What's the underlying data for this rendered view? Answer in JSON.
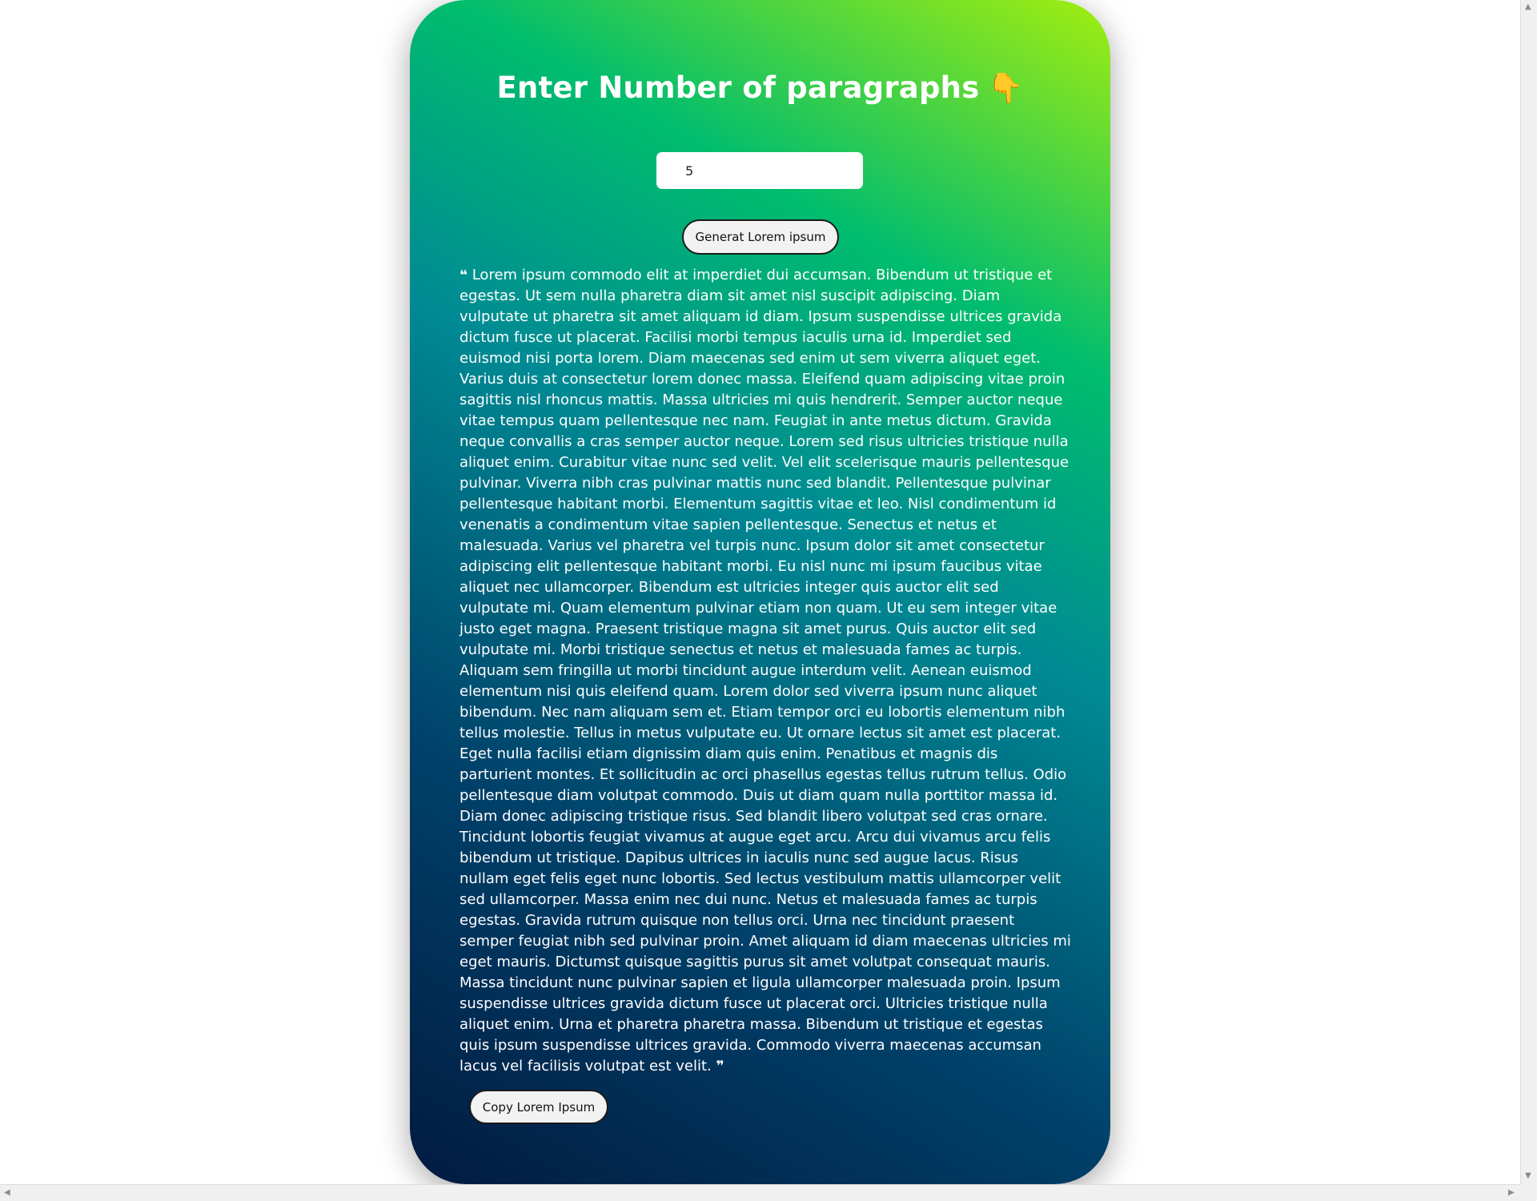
{
  "header": {
    "title": "Enter Number of paragraphs",
    "title_emoji": "👇"
  },
  "form": {
    "paragraph_count_value": "5",
    "generate_button_label": "Generat Lorem ipsum"
  },
  "output": {
    "open_quote": "❝",
    "close_quote": "❞",
    "text": "Lorem ipsum commodo elit at imperdiet dui accumsan. Bibendum ut tristique et egestas. Ut sem nulla pharetra diam sit amet nisl suscipit adipiscing. Diam vulputate ut pharetra sit amet aliquam id diam. Ipsum suspendisse ultrices gravida dictum fusce ut placerat. Facilisi morbi tempus iaculis urna id. Imperdiet sed euismod nisi porta lorem. Diam maecenas sed enim ut sem viverra aliquet eget. Varius duis at consectetur lorem donec massa. Eleifend quam adipiscing vitae proin sagittis nisl rhoncus mattis. Massa ultricies mi quis hendrerit. Semper auctor neque vitae tempus quam pellentesque nec nam. Feugiat in ante metus dictum. Gravida neque convallis a cras semper auctor neque. Lorem sed risus ultricies tristique nulla aliquet enim. Curabitur vitae nunc sed velit. Vel elit scelerisque mauris pellentesque pulvinar. Viverra nibh cras pulvinar mattis nunc sed blandit. Pellentesque pulvinar pellentesque habitant morbi. Elementum sagittis vitae et leo. Nisl condimentum id venenatis a condimentum vitae sapien pellentesque. Senectus et netus et malesuada. Varius vel pharetra vel turpis nunc. Ipsum dolor sit amet consectetur adipiscing elit pellentesque habitant morbi. Eu nisl nunc mi ipsum faucibus vitae aliquet nec ullamcorper. Bibendum est ultricies integer quis auctor elit sed vulputate mi. Quam elementum pulvinar etiam non quam. Ut eu sem integer vitae justo eget magna. Praesent tristique magna sit amet purus. Quis auctor elit sed vulputate mi. Morbi tristique senectus et netus et malesuada fames ac turpis. Aliquam sem fringilla ut morbi tincidunt augue interdum velit. Aenean euismod elementum nisi quis eleifend quam. Lorem dolor sed viverra ipsum nunc aliquet bibendum. Nec nam aliquam sem et. Etiam tempor orci eu lobortis elementum nibh tellus molestie. Tellus in metus vulputate eu. Ut ornare lectus sit amet est placerat. Eget nulla facilisi etiam dignissim diam quis enim. Penatibus et magnis dis parturient montes. Et sollicitudin ac orci phasellus egestas tellus rutrum tellus. Odio pellentesque diam volutpat commodo. Duis ut diam quam nulla porttitor massa id. Diam donec adipiscing tristique risus. Sed blandit libero volutpat sed cras ornare. Tincidunt lobortis feugiat vivamus at augue eget arcu. Arcu dui vivamus arcu felis bibendum ut tristique. Dapibus ultrices in iaculis nunc sed augue lacus. Risus nullam eget felis eget nunc lobortis. Sed lectus vestibulum mattis ullamcorper velit sed ullamcorper. Massa enim nec dui nunc. Netus et malesuada fames ac turpis egestas. Gravida rutrum quisque non tellus orci. Urna nec tincidunt praesent semper feugiat nibh sed pulvinar proin. Amet aliquam id diam maecenas ultricies mi eget mauris. Dictumst quisque sagittis purus sit amet volutpat consequat mauris. Massa tincidunt nunc pulvinar sapien et ligula ullamcorper malesuada proin. Ipsum suspendisse ultrices gravida dictum fusce ut placerat orci. Ultricies tristique nulla aliquet enim. Urna et pharetra pharetra massa. Bibendum ut tristique et egestas quis ipsum suspendisse ultrices gravida. Commodo viverra maecenas accumsan lacus vel facilisis volutpat est velit.",
    "copy_button_label": "Copy Lorem Ipsum"
  },
  "scrollbars": {
    "left_arrow": "◀",
    "right_arrow": "▶",
    "up_arrow": "▲",
    "down_arrow": "▼"
  },
  "colors": {
    "gradient_top_right": "#a3ee0e",
    "gradient_mid": "#00bd6e",
    "gradient_teal": "#008a94",
    "gradient_bottom_left": "#021a40",
    "title_emoji": "#f4b400"
  }
}
